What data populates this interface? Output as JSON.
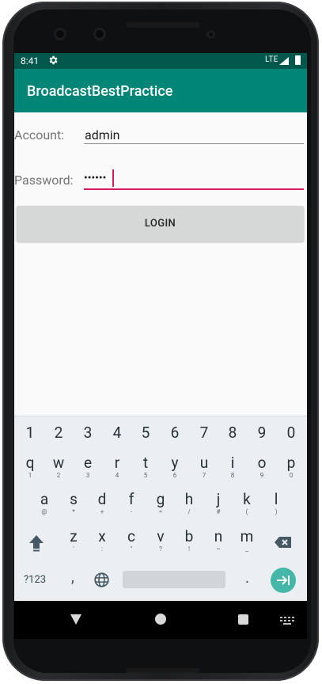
{
  "status_bar": {
    "time": "8:41",
    "network": "LTE"
  },
  "app_bar": {
    "title": "BroadcastBestPractice"
  },
  "form": {
    "account_label": "Account:",
    "account_value": "admin",
    "password_label": "Password:",
    "password_value": "••••••",
    "login_button": "LOGIN"
  },
  "keyboard": {
    "number_row": [
      "1",
      "2",
      "3",
      "4",
      "5",
      "6",
      "7",
      "8",
      "9",
      "0"
    ],
    "row1": [
      {
        "key": "q",
        "alt": "1"
      },
      {
        "key": "w",
        "alt": "2"
      },
      {
        "key": "e",
        "alt": "3"
      },
      {
        "key": "r",
        "alt": "4"
      },
      {
        "key": "t",
        "alt": "5"
      },
      {
        "key": "y",
        "alt": "6"
      },
      {
        "key": "u",
        "alt": "7"
      },
      {
        "key": "i",
        "alt": "8"
      },
      {
        "key": "o",
        "alt": "9"
      },
      {
        "key": "p",
        "alt": "0"
      }
    ],
    "row2": [
      {
        "key": "a",
        "alt": "@"
      },
      {
        "key": "s",
        "alt": "*"
      },
      {
        "key": "d",
        "alt": "+"
      },
      {
        "key": "f",
        "alt": "-"
      },
      {
        "key": "g",
        "alt": "="
      },
      {
        "key": "h",
        "alt": "/"
      },
      {
        "key": "j",
        "alt": "#"
      },
      {
        "key": "k",
        "alt": "("
      },
      {
        "key": "l",
        "alt": ")"
      }
    ],
    "row3": [
      {
        "key": "z",
        "alt": "'"
      },
      {
        "key": "x",
        "alt": ":"
      },
      {
        "key": "c",
        "alt": "\""
      },
      {
        "key": "v",
        "alt": "?"
      },
      {
        "key": "b",
        "alt": "!"
      },
      {
        "key": "n",
        "alt": "~"
      },
      {
        "key": "m",
        "alt": "_"
      }
    ],
    "symbols_key": "?123",
    "comma_key": ",",
    "period_key": "."
  },
  "colors": {
    "status_bar": "#00574b",
    "app_bar": "#008577",
    "accent": "#d81b60",
    "enter_key": "#45b7a9"
  },
  "icons": [
    "settings-gear-icon",
    "signal-icon",
    "battery-icon",
    "shift-icon",
    "backspace-icon",
    "globe-icon",
    "enter-icon",
    "back-icon",
    "home-icon",
    "recents-icon",
    "keyboard-switch-icon"
  ]
}
